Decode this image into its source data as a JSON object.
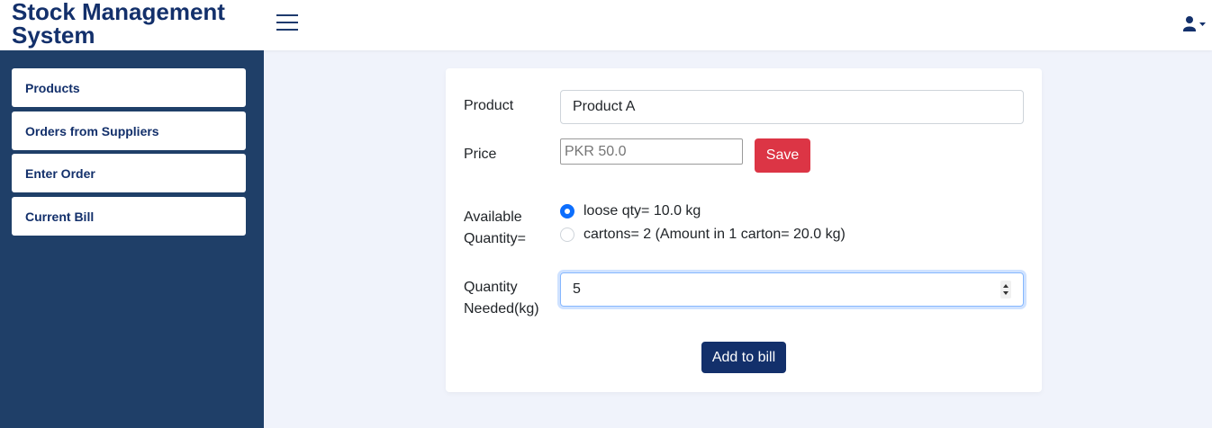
{
  "app": {
    "title": "Stock Management System"
  },
  "sidebar": {
    "items": [
      {
        "label": "Products"
      },
      {
        "label": "Orders from Suppliers"
      },
      {
        "label": "Enter Order"
      },
      {
        "label": "Current Bill"
      }
    ]
  },
  "form": {
    "product_label": "Product",
    "product_value": "Product A",
    "price_label": "Price",
    "price_placeholder": "PKR 50.0",
    "save_label": "Save",
    "available_label_line1": "Available",
    "available_label_line2": "Quantity=",
    "radio_loose": "loose qty= 10.0 kg",
    "radio_cartons": "cartons= 2 (Amount in 1 carton= 20.0 kg)",
    "radio_selected": "loose",
    "qty_label_line1": "Quantity",
    "qty_label_line2": "Needed(kg)",
    "qty_value": "5",
    "add_label": "Add to bill"
  },
  "icons": {
    "menu": "hamburger-menu-icon",
    "user": "user-icon",
    "caret": "caret-down-icon"
  },
  "colors": {
    "brand": "#13306b",
    "sidebar_bg": "#1f3f68",
    "save_button": "#dc3545",
    "add_button": "#13306b",
    "radio_selected": "#0d6efd",
    "page_bg": "#f0f3fb"
  }
}
